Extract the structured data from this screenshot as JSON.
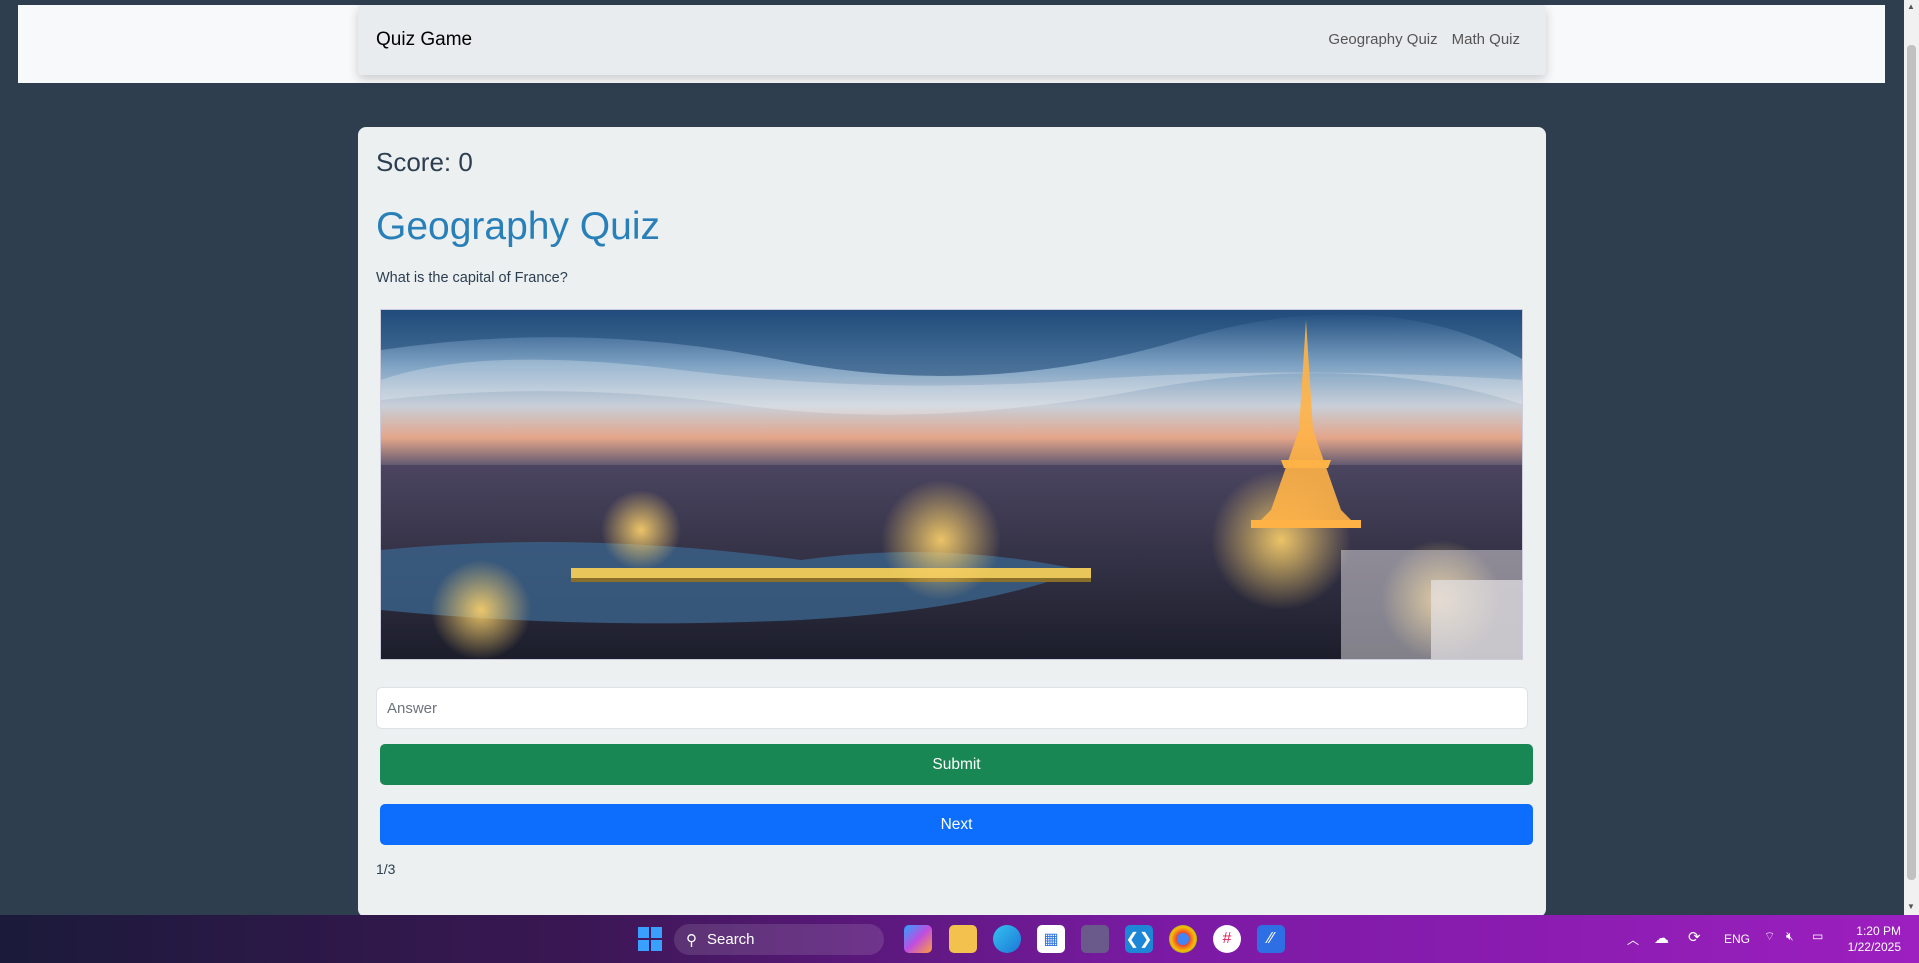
{
  "navbar": {
    "brand": "Quiz Game",
    "links": [
      "Geography Quiz",
      "Math Quiz"
    ]
  },
  "quiz": {
    "score_label": "Score: 0",
    "title": "Geography Quiz",
    "question": "What is the capital of France?",
    "image_alt": "Paris skyline with Eiffel Tower at dusk",
    "answer_placeholder": "Answer",
    "answer_value": "",
    "submit_label": "Submit",
    "next_label": "Next",
    "progress": "1/3"
  },
  "taskbar": {
    "search_label": "Search",
    "language": "ENG",
    "time": "1:20 PM",
    "date": "1/22/2025",
    "apps": [
      "windows-start-icon",
      "search-icon",
      "copilot-icon",
      "file-explorer-icon",
      "edge-icon",
      "store-icon",
      "teams-icon",
      "vscode-icon",
      "chrome-icon",
      "slack-icon",
      "app-icon"
    ]
  },
  "colors": {
    "page_bg": "#2e3e4f",
    "title": "#2980b9",
    "submit": "#198754",
    "next": "#0d6efd"
  }
}
